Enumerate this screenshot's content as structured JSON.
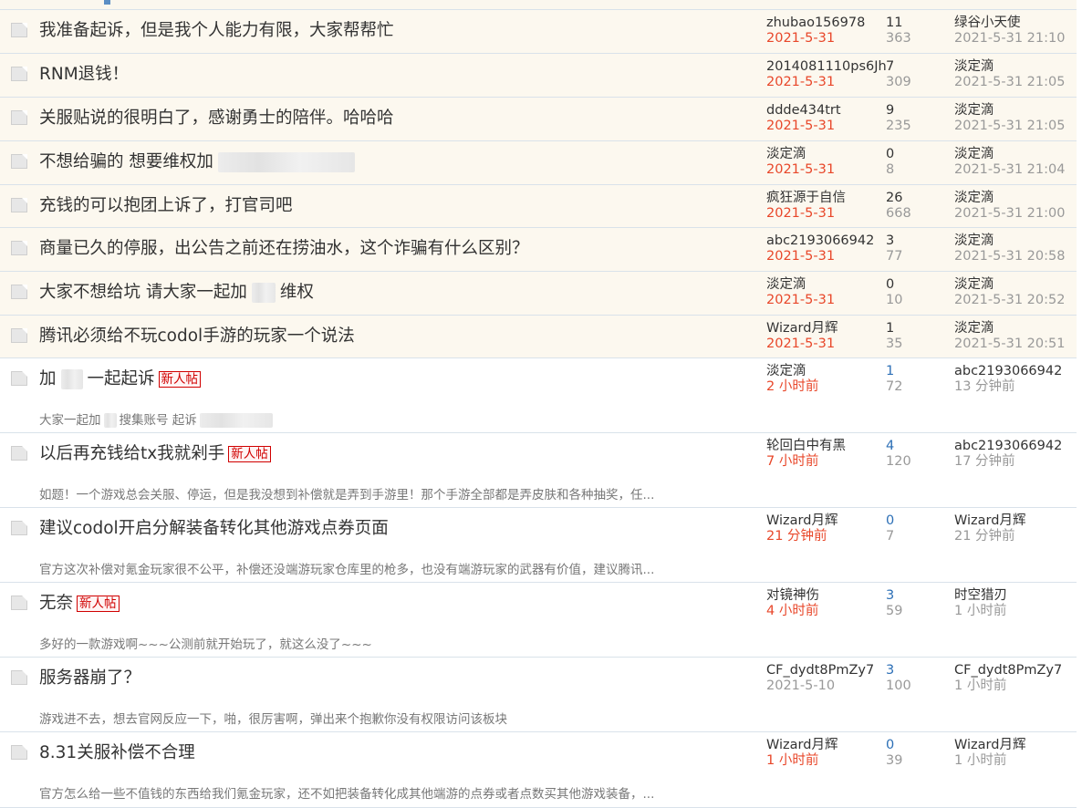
{
  "threads": [
    {
      "kind": "sticky",
      "title": [
        "我准备起诉，但是我个人能力有限，大家帮帮忙"
      ],
      "author": "zhubao156978",
      "author_date": "2021-5-31",
      "author_date_recent": true,
      "replies": "11",
      "views": "363",
      "last_user": "绿谷小天使",
      "last_time": "2021-5-31 21:10"
    },
    {
      "kind": "sticky",
      "title": [
        "RNM退钱！"
      ],
      "author": "2014081110ps6Jh",
      "author_date": "2021-5-31",
      "author_date_recent": true,
      "replies": "7",
      "views": "309",
      "last_user": "淡定滴",
      "last_time": "2021-5-31 21:05"
    },
    {
      "kind": "sticky",
      "title": [
        "关服贴说的很明白了，感谢勇士的陪伴。哈哈哈"
      ],
      "author": "ddde434trt",
      "author_date": "2021-5-31",
      "author_date_recent": true,
      "replies": "9",
      "views": "235",
      "last_user": "淡定滴",
      "last_time": "2021-5-31 21:05"
    },
    {
      "kind": "sticky",
      "title": [
        "不想给骗的 想要维权加",
        ""
      ],
      "author": "淡定滴",
      "author_date": "2021-5-31",
      "author_date_recent": true,
      "replies": "0",
      "views": "8",
      "last_user": "淡定滴",
      "last_time": "2021-5-31 21:04"
    },
    {
      "kind": "sticky",
      "title": [
        "充钱的可以抱团上诉了，打官司吧"
      ],
      "author": "疯狂源于自信",
      "author_date": "2021-5-31",
      "author_date_recent": true,
      "replies": "26",
      "views": "668",
      "last_user": "淡定滴",
      "last_time": "2021-5-31 21:00"
    },
    {
      "kind": "sticky",
      "title": [
        "商量已久的停服，出公告之前还在捞油水，这个诈骗有什么区别？"
      ],
      "author": "abc2193066942",
      "author_date": "2021-5-31",
      "author_date_recent": true,
      "replies": "3",
      "views": "77",
      "last_user": "淡定滴",
      "last_time": "2021-5-31 20:58"
    },
    {
      "kind": "sticky",
      "title": [
        "大家不想给坑 请大家一起加",
        "",
        "维权"
      ],
      "author": "淡定滴",
      "author_date": "2021-5-31",
      "author_date_recent": true,
      "replies": "0",
      "views": "10",
      "last_user": "淡定滴",
      "last_time": "2021-5-31 20:52"
    },
    {
      "kind": "sticky",
      "title": [
        "腾讯必须给不玩codol手游的玩家一个说法"
      ],
      "author": "Wizard月辉",
      "author_date": "2021-5-31",
      "author_date_recent": true,
      "replies": "1",
      "views": "35",
      "last_user": "淡定滴",
      "last_time": "2021-5-31 20:51"
    },
    {
      "kind": "normal",
      "title": [
        "加",
        "",
        "一起起诉"
      ],
      "badge": "新人帖",
      "excerpt": [
        "大家一起加",
        "",
        "搜集账号 起诉",
        ""
      ],
      "author": "淡定滴",
      "author_date": "2 小时前",
      "author_date_recent": true,
      "replies": "1",
      "views": "72",
      "last_user": "abc2193066942",
      "last_time": "13 分钟前"
    },
    {
      "kind": "normal",
      "title": [
        "以后再充钱给tx我就剁手"
      ],
      "badge": "新人帖",
      "excerpt": [
        "如题！一个游戏总会关服、停运，但是我没想到补偿就是弄到手游里！那个手游全部都是弄皮肤和各种抽奖，任..."
      ],
      "author": "轮回白中有黑",
      "author_date": "7 小时前",
      "author_date_recent": true,
      "replies": "4",
      "views": "120",
      "last_user": "abc2193066942",
      "last_time": "17 分钟前"
    },
    {
      "kind": "normal",
      "title": [
        "建议codol开启分解装备转化其他游戏点券页面"
      ],
      "excerpt": [
        "官方这次补偿对氪金玩家很不公平，补偿还没端游玩家仓库里的枪多，也没有端游玩家的武器有价值，建议腾讯..."
      ],
      "author": "Wizard月辉",
      "author_date": "21 分钟前",
      "author_date_recent": true,
      "replies": "0",
      "views": "7",
      "last_user": "Wizard月辉",
      "last_time": "21 分钟前"
    },
    {
      "kind": "normal",
      "title": [
        "无奈"
      ],
      "badge": "新人帖",
      "excerpt": [
        "多好的一款游戏啊~~~公测前就开始玩了，就这么没了~~~"
      ],
      "author": "对镜神伤",
      "author_date": "4 小时前",
      "author_date_recent": true,
      "replies": "3",
      "views": "59",
      "last_user": "时空猎刃",
      "last_time": "1 小时前"
    },
    {
      "kind": "normal",
      "title": [
        "服务器崩了？"
      ],
      "excerpt": [
        "游戏进不去，想去官网反应一下，啪，很厉害啊，弹出来个抱歉你没有权限访问该板块"
      ],
      "author": "CF_dydt8PmZy7",
      "author_date": "2021-5-10",
      "author_date_recent": false,
      "replies": "3",
      "views": "100",
      "last_user": "CF_dydt8PmZy7",
      "last_time": "1 小时前"
    },
    {
      "kind": "normal",
      "title": [
        "8.31关服补偿不合理"
      ],
      "excerpt": [
        "官方怎么给一些不值钱的东西给我们氪金玩家，还不如把装备转化成其他端游的点券或者点数买其他游戏装备，..."
      ],
      "author": "Wizard月辉",
      "author_date": "1 小时前",
      "author_date_recent": true,
      "replies": "0",
      "views": "39",
      "last_user": "Wizard月辉",
      "last_time": "1 小时前"
    }
  ]
}
